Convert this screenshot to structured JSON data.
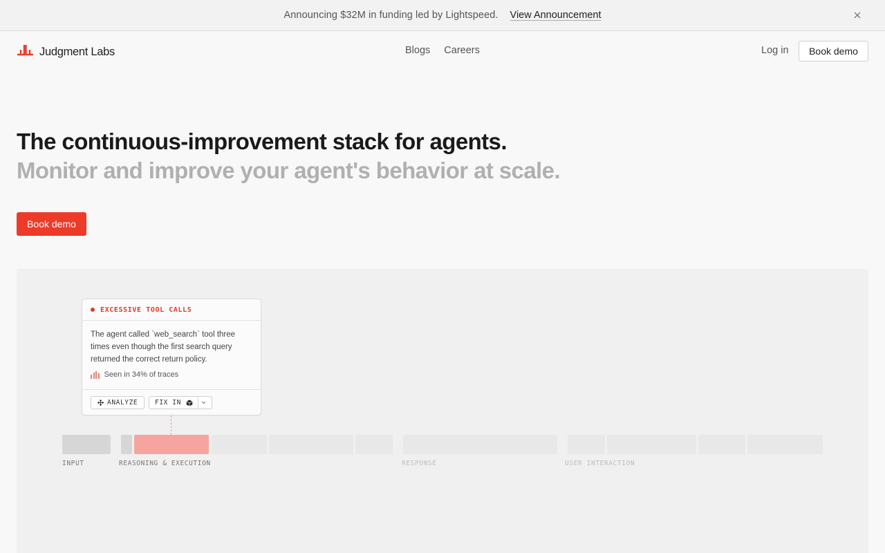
{
  "announcement": {
    "text": "Announcing $32M in funding led by Lightspeed.",
    "link": "View Announcement",
    "close_icon": "close-icon"
  },
  "nav": {
    "logo_text": "Judgment Labs",
    "links": [
      "Blogs",
      "Careers"
    ],
    "login": "Log in",
    "cta": "Book demo"
  },
  "hero": {
    "title": "The continuous-improvement stack for agents.",
    "subtitle": "Monitor and improve your agent's behavior at scale.",
    "cta": "Book demo"
  },
  "card": {
    "title": "EXCESSIVE TOOL CALLS",
    "description": "The agent called `web_search` tool three times even though the first search query returned the correct return policy.",
    "seen": "Seen in 34% of traces",
    "analyze": "ANALYZE",
    "fix": "FIX IN"
  },
  "timeline": {
    "lanes": [
      "INPUT",
      "REASONING & EXECUTION",
      "RESPONSE",
      "USER INTERACTION"
    ]
  },
  "colors": {
    "accent": "#ee3a28",
    "highlight": "#f5a59d",
    "background": "#f8f8f8",
    "panel": "#f0f0f0"
  }
}
